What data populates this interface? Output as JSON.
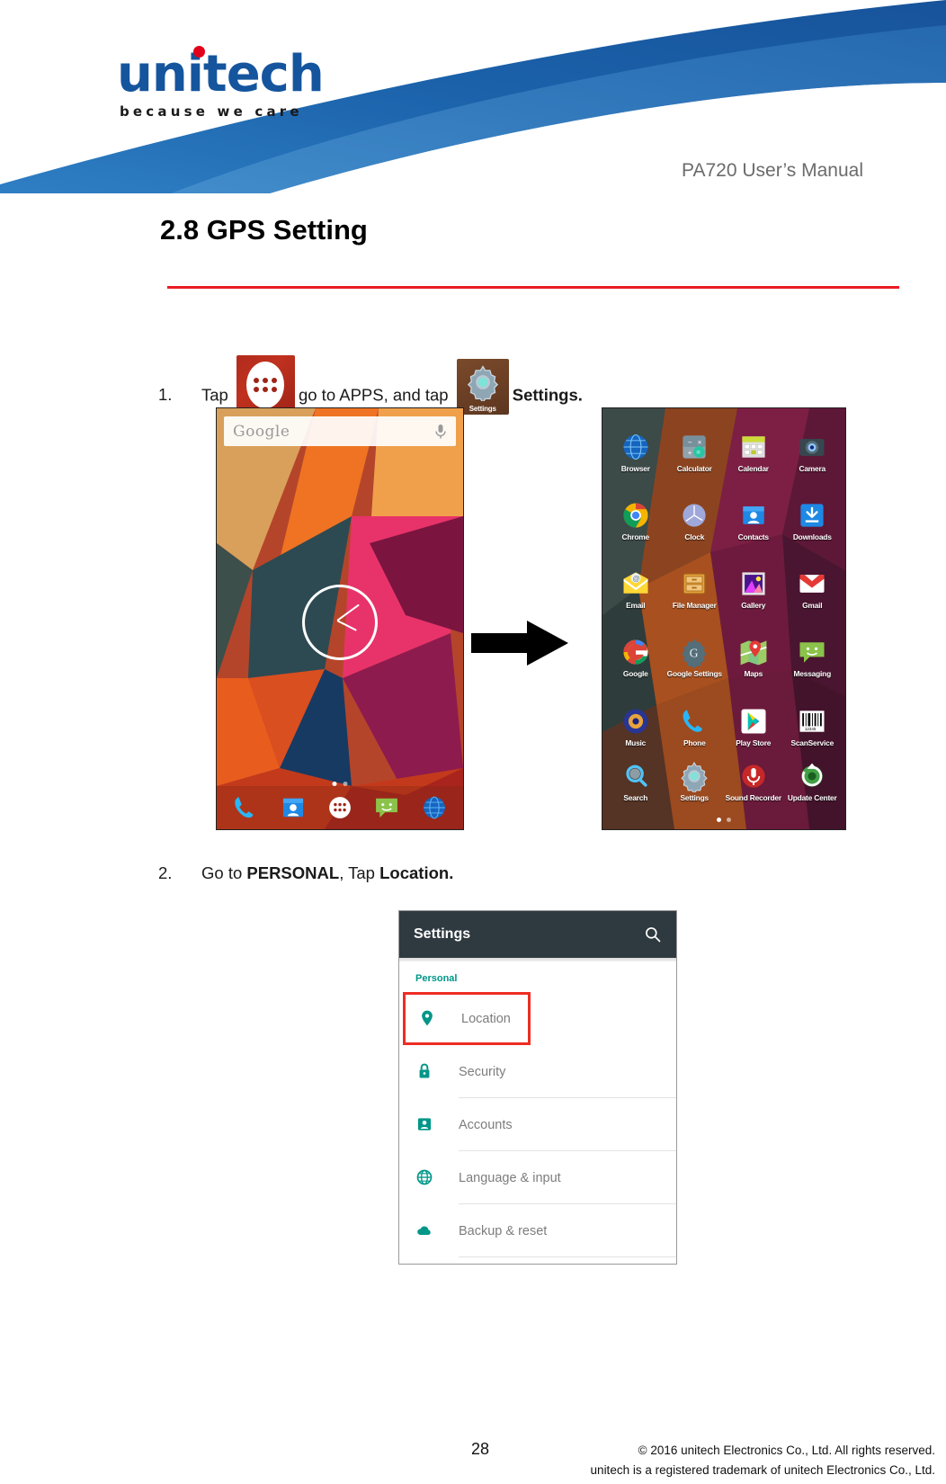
{
  "header": {
    "logo_word": "unitech",
    "logo_tagline": "because we care",
    "manual_title": "PA720 User’s Manual"
  },
  "section": {
    "title": "2.8 GPS Setting"
  },
  "steps": [
    {
      "number": "1.",
      "text_before": "Tap",
      "text_middle": "go to APPS, and tap",
      "text_bold": "Settings.",
      "icon_apps": "apps-drawer-icon",
      "icon_settings": "settings-gear-icon",
      "icon_settings_label": "Settings"
    },
    {
      "number": "2.",
      "text_before": "Go to",
      "bold1": "PERSONAL",
      "text_middle": ", Tap",
      "bold2": "Location."
    }
  ],
  "home_screen": {
    "search_placeholder": "Google",
    "mic_icon": "microphone-icon",
    "clock_widget": "analog-clock-widget",
    "page_dots": 2,
    "page_active": 1,
    "dock": [
      {
        "name": "phone-icon",
        "color": "#29b6f6"
      },
      {
        "name": "contacts-icon",
        "color": "#2196f3"
      },
      {
        "name": "apps-drawer-icon",
        "color": "#ffffff"
      },
      {
        "name": "messaging-icon",
        "color": "#8bc34a"
      },
      {
        "name": "browser-icon",
        "color": "#1e88e5"
      }
    ]
  },
  "apps_screen": {
    "page_dots": 2,
    "page_active": 1,
    "apps": [
      {
        "label": "Browser",
        "icon": "browser-globe-icon",
        "color": "#1e88e5"
      },
      {
        "label": "Calculator",
        "icon": "calculator-icon",
        "color": "#607d8b"
      },
      {
        "label": "Calendar",
        "icon": "calendar-icon",
        "color": "#cddc39"
      },
      {
        "label": "Camera",
        "icon": "camera-icon",
        "color": "#37474f"
      },
      {
        "label": "Chrome",
        "icon": "chrome-icon",
        "color": "#4285f4"
      },
      {
        "label": "Clock",
        "icon": "clock-icon",
        "color": "#9fa8da"
      },
      {
        "label": "Contacts",
        "icon": "contacts-icon",
        "color": "#2196f3"
      },
      {
        "label": "Downloads",
        "icon": "downloads-icon",
        "color": "#2196f3"
      },
      {
        "label": "Email",
        "icon": "email-icon",
        "color": "#ffc107"
      },
      {
        "label": "File Manager",
        "icon": "file-manager-icon",
        "color": "#e8a33d"
      },
      {
        "label": "Gallery",
        "icon": "gallery-icon",
        "color": "#e040fb"
      },
      {
        "label": "Gmail",
        "icon": "gmail-icon",
        "color": "#e53935"
      },
      {
        "label": "Google",
        "icon": "google-icon",
        "color": "#4285f4"
      },
      {
        "label": "Google Settings",
        "icon": "google-settings-icon",
        "color": "#546e7a"
      },
      {
        "label": "Maps",
        "icon": "maps-icon",
        "color": "#4caf50"
      },
      {
        "label": "Messaging",
        "icon": "messaging-icon",
        "color": "#8bc34a"
      },
      {
        "label": "Music",
        "icon": "music-icon",
        "color": "#3f51b5"
      },
      {
        "label": "Phone",
        "icon": "phone-icon",
        "color": "#29b6f6"
      },
      {
        "label": "Play Store",
        "icon": "play-store-icon",
        "color": "#ffffff"
      },
      {
        "label": "ScanService",
        "icon": "scan-service-barcode-icon",
        "color": "#ffffff"
      },
      {
        "label": "Search",
        "icon": "search-magnifier-icon",
        "color": "#4fc3f7"
      },
      {
        "label": "Settings",
        "icon": "settings-gear-icon",
        "color": "#90a4ae"
      },
      {
        "label": "Sound Recorder",
        "icon": "sound-recorder-icon",
        "color": "#e53935"
      },
      {
        "label": "Update Center",
        "icon": "update-center-icon",
        "color": "#4caf50"
      }
    ]
  },
  "settings_screen": {
    "title": "Settings",
    "search_icon": "search-icon",
    "group_label": "Personal",
    "accent_color": "#009688",
    "highlight_color": "#ee2d24",
    "appbar_color": "#2f3a40",
    "items": [
      {
        "label": "Location",
        "icon": "location-pin-icon",
        "highlighted": true
      },
      {
        "label": "Security",
        "icon": "lock-icon",
        "highlighted": false
      },
      {
        "label": "Accounts",
        "icon": "accounts-icon",
        "highlighted": false
      },
      {
        "label": "Language & input",
        "icon": "globe-icon",
        "highlighted": false
      },
      {
        "label": "Backup & reset",
        "icon": "cloud-icon",
        "highlighted": false
      }
    ]
  },
  "footer": {
    "page_number": "28",
    "copyright": "© 2016 unitech Electronics Co., Ltd. All rights reserved.",
    "trademark": "unitech is a registered trademark of unitech Electronics Co., Ltd."
  }
}
